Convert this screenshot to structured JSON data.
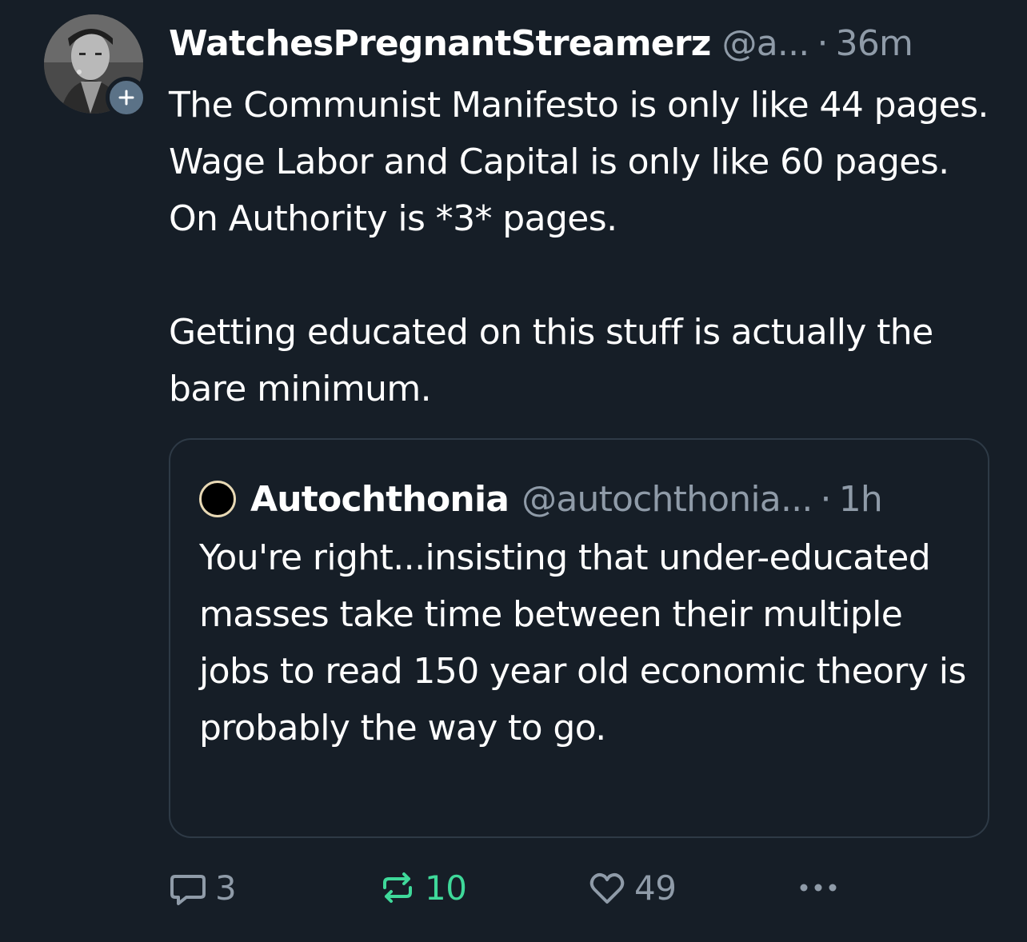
{
  "post": {
    "display_name": "WatchesPregnantStreamerz",
    "handle": "@a...",
    "separator": "·",
    "time": "36m",
    "text": "The Communist Manifesto is only like 44 pages. Wage Labor and Capital is only like 60 pages. On Authority is *3* pages.\n\nGetting educated on this stuff is actually the bare minimum.",
    "avatar_icon": "person-photo-avatar",
    "follow_icon": "plus-icon"
  },
  "quote": {
    "display_name": "Autochthonia",
    "handle": "@autochthonia...",
    "separator": "·",
    "time": "1h",
    "text": "You're right...insisting that under-educated masses take time between their multiple jobs to read 150 year old economic theory is probably the way to go.",
    "avatar_icon": "black-circle-avatar"
  },
  "actions": {
    "reply_count": "3",
    "repost_count": "10",
    "like_count": "49",
    "reply_icon": "speech-bubble-icon",
    "repost_icon": "repost-arrows-icon",
    "like_icon": "heart-icon",
    "more_icon": "ellipsis-icon"
  },
  "colors": {
    "background": "#161e27",
    "text_primary": "#ffffff",
    "text_secondary": "#8f9ba8",
    "repost_active": "#3fd99a",
    "card_border": "#2e3a46",
    "follow_badge": "#5b7287"
  }
}
